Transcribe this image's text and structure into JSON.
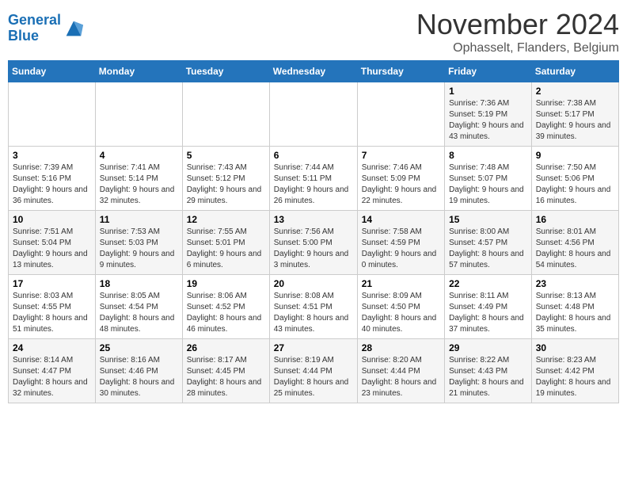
{
  "logo": {
    "line1": "General",
    "line2": "Blue"
  },
  "title": "November 2024",
  "location": "Ophasselt, Flanders, Belgium",
  "days_of_week": [
    "Sunday",
    "Monday",
    "Tuesday",
    "Wednesday",
    "Thursday",
    "Friday",
    "Saturday"
  ],
  "weeks": [
    [
      {
        "day": "",
        "info": ""
      },
      {
        "day": "",
        "info": ""
      },
      {
        "day": "",
        "info": ""
      },
      {
        "day": "",
        "info": ""
      },
      {
        "day": "",
        "info": ""
      },
      {
        "day": "1",
        "info": "Sunrise: 7:36 AM\nSunset: 5:19 PM\nDaylight: 9 hours and 43 minutes."
      },
      {
        "day": "2",
        "info": "Sunrise: 7:38 AM\nSunset: 5:17 PM\nDaylight: 9 hours and 39 minutes."
      }
    ],
    [
      {
        "day": "3",
        "info": "Sunrise: 7:39 AM\nSunset: 5:16 PM\nDaylight: 9 hours and 36 minutes."
      },
      {
        "day": "4",
        "info": "Sunrise: 7:41 AM\nSunset: 5:14 PM\nDaylight: 9 hours and 32 minutes."
      },
      {
        "day": "5",
        "info": "Sunrise: 7:43 AM\nSunset: 5:12 PM\nDaylight: 9 hours and 29 minutes."
      },
      {
        "day": "6",
        "info": "Sunrise: 7:44 AM\nSunset: 5:11 PM\nDaylight: 9 hours and 26 minutes."
      },
      {
        "day": "7",
        "info": "Sunrise: 7:46 AM\nSunset: 5:09 PM\nDaylight: 9 hours and 22 minutes."
      },
      {
        "day": "8",
        "info": "Sunrise: 7:48 AM\nSunset: 5:07 PM\nDaylight: 9 hours and 19 minutes."
      },
      {
        "day": "9",
        "info": "Sunrise: 7:50 AM\nSunset: 5:06 PM\nDaylight: 9 hours and 16 minutes."
      }
    ],
    [
      {
        "day": "10",
        "info": "Sunrise: 7:51 AM\nSunset: 5:04 PM\nDaylight: 9 hours and 13 minutes."
      },
      {
        "day": "11",
        "info": "Sunrise: 7:53 AM\nSunset: 5:03 PM\nDaylight: 9 hours and 9 minutes."
      },
      {
        "day": "12",
        "info": "Sunrise: 7:55 AM\nSunset: 5:01 PM\nDaylight: 9 hours and 6 minutes."
      },
      {
        "day": "13",
        "info": "Sunrise: 7:56 AM\nSunset: 5:00 PM\nDaylight: 9 hours and 3 minutes."
      },
      {
        "day": "14",
        "info": "Sunrise: 7:58 AM\nSunset: 4:59 PM\nDaylight: 9 hours and 0 minutes."
      },
      {
        "day": "15",
        "info": "Sunrise: 8:00 AM\nSunset: 4:57 PM\nDaylight: 8 hours and 57 minutes."
      },
      {
        "day": "16",
        "info": "Sunrise: 8:01 AM\nSunset: 4:56 PM\nDaylight: 8 hours and 54 minutes."
      }
    ],
    [
      {
        "day": "17",
        "info": "Sunrise: 8:03 AM\nSunset: 4:55 PM\nDaylight: 8 hours and 51 minutes."
      },
      {
        "day": "18",
        "info": "Sunrise: 8:05 AM\nSunset: 4:54 PM\nDaylight: 8 hours and 48 minutes."
      },
      {
        "day": "19",
        "info": "Sunrise: 8:06 AM\nSunset: 4:52 PM\nDaylight: 8 hours and 46 minutes."
      },
      {
        "day": "20",
        "info": "Sunrise: 8:08 AM\nSunset: 4:51 PM\nDaylight: 8 hours and 43 minutes."
      },
      {
        "day": "21",
        "info": "Sunrise: 8:09 AM\nSunset: 4:50 PM\nDaylight: 8 hours and 40 minutes."
      },
      {
        "day": "22",
        "info": "Sunrise: 8:11 AM\nSunset: 4:49 PM\nDaylight: 8 hours and 37 minutes."
      },
      {
        "day": "23",
        "info": "Sunrise: 8:13 AM\nSunset: 4:48 PM\nDaylight: 8 hours and 35 minutes."
      }
    ],
    [
      {
        "day": "24",
        "info": "Sunrise: 8:14 AM\nSunset: 4:47 PM\nDaylight: 8 hours and 32 minutes."
      },
      {
        "day": "25",
        "info": "Sunrise: 8:16 AM\nSunset: 4:46 PM\nDaylight: 8 hours and 30 minutes."
      },
      {
        "day": "26",
        "info": "Sunrise: 8:17 AM\nSunset: 4:45 PM\nDaylight: 8 hours and 28 minutes."
      },
      {
        "day": "27",
        "info": "Sunrise: 8:19 AM\nSunset: 4:44 PM\nDaylight: 8 hours and 25 minutes."
      },
      {
        "day": "28",
        "info": "Sunrise: 8:20 AM\nSunset: 4:44 PM\nDaylight: 8 hours and 23 minutes."
      },
      {
        "day": "29",
        "info": "Sunrise: 8:22 AM\nSunset: 4:43 PM\nDaylight: 8 hours and 21 minutes."
      },
      {
        "day": "30",
        "info": "Sunrise: 8:23 AM\nSunset: 4:42 PM\nDaylight: 8 hours and 19 minutes."
      }
    ]
  ]
}
